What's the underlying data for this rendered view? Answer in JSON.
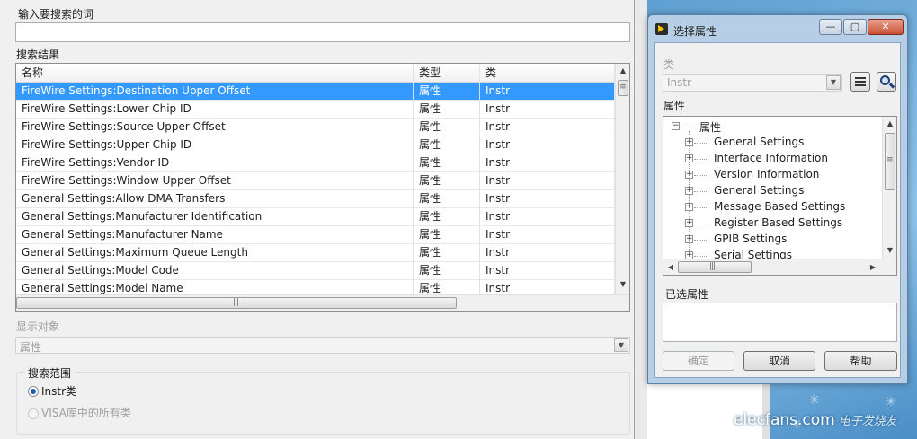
{
  "search_window": {
    "search_label": "输入要搜索的词",
    "search_value": "",
    "results_label": "搜索结果",
    "columns": [
      "名称",
      "类型",
      "类"
    ],
    "rows": [
      [
        "FireWire Settings:Destination Upper Offset",
        "属性",
        "Instr"
      ],
      [
        "FireWire Settings:Lower Chip ID",
        "属性",
        "Instr"
      ],
      [
        "FireWire Settings:Source Upper Offset",
        "属性",
        "Instr"
      ],
      [
        "FireWire Settings:Upper Chip ID",
        "属性",
        "Instr"
      ],
      [
        "FireWire Settings:Vendor ID",
        "属性",
        "Instr"
      ],
      [
        "FireWire Settings:Window Upper Offset",
        "属性",
        "Instr"
      ],
      [
        "General Settings:Allow DMA Transfers",
        "属性",
        "Instr"
      ],
      [
        "General Settings:Manufacturer Identification",
        "属性",
        "Instr"
      ],
      [
        "General Settings:Manufacturer Name",
        "属性",
        "Instr"
      ],
      [
        "General Settings:Maximum Queue Length",
        "属性",
        "Instr"
      ],
      [
        "General Settings:Model Code",
        "属性",
        "Instr"
      ],
      [
        "General Settings:Model Name",
        "属性",
        "Instr"
      ]
    ],
    "selected_row": 0,
    "display_object_label": "显示对象",
    "display_object_value": "属性",
    "scope_label": "搜索范围",
    "scope_options": [
      "Instr类",
      "VISA库中的所有类"
    ],
    "scope_selected": 0
  },
  "dialog": {
    "title": "选择属性",
    "class_label": "类",
    "class_value": "Instr",
    "properties_label": "属性",
    "tree_root": "属性",
    "tree_items": [
      "General Settings",
      "Interface Information",
      "Version Information",
      "General Settings",
      "Message Based Settings",
      "Register Based Settings",
      "GPIB Settings",
      "Serial Settings"
    ],
    "selected_properties_label": "已选属性",
    "selected_properties_value": "",
    "buttons": {
      "ok": "确定",
      "cancel": "取消",
      "help": "帮助"
    },
    "icons": {
      "list": "list-icon",
      "search": "magnifier-icon"
    }
  },
  "watermark": {
    "site": "elecfans.com",
    "site_cn": "电子发烧友"
  },
  "colors": {
    "selection": "#3399ff",
    "dialog_frame": "#b7cfe6",
    "desktop": "#6aa8d8"
  }
}
